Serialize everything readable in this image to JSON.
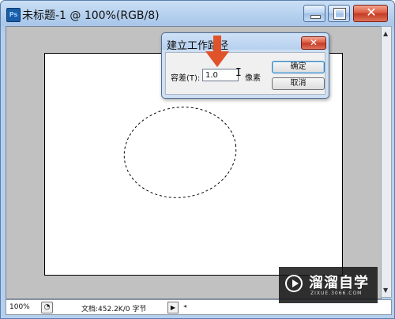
{
  "window": {
    "app_icon_text": "Ps",
    "title": "未标题-1 @ 100%(RGB/8)",
    "close_glyph": "✕"
  },
  "dialog": {
    "title": "建立工作路径",
    "close_glyph": "✕",
    "tolerance_label": "容差(T):",
    "tolerance_value": "1.0",
    "unit": "像素",
    "ok_label": "确定",
    "cancel_label": "取消"
  },
  "status": {
    "zoom": "100%",
    "icon": "◔",
    "doc_info": "文档:452.2K/0 字节",
    "menu_arrow": "▶",
    "scroll_left": "◂"
  },
  "watermark": {
    "text": "溜溜自学",
    "url": "ZIXUE.3066.COM"
  },
  "colors": {
    "arrow": "#e0522a",
    "title_bar": "#a9c7ea",
    "canvas_gray": "#c1c1c1"
  }
}
